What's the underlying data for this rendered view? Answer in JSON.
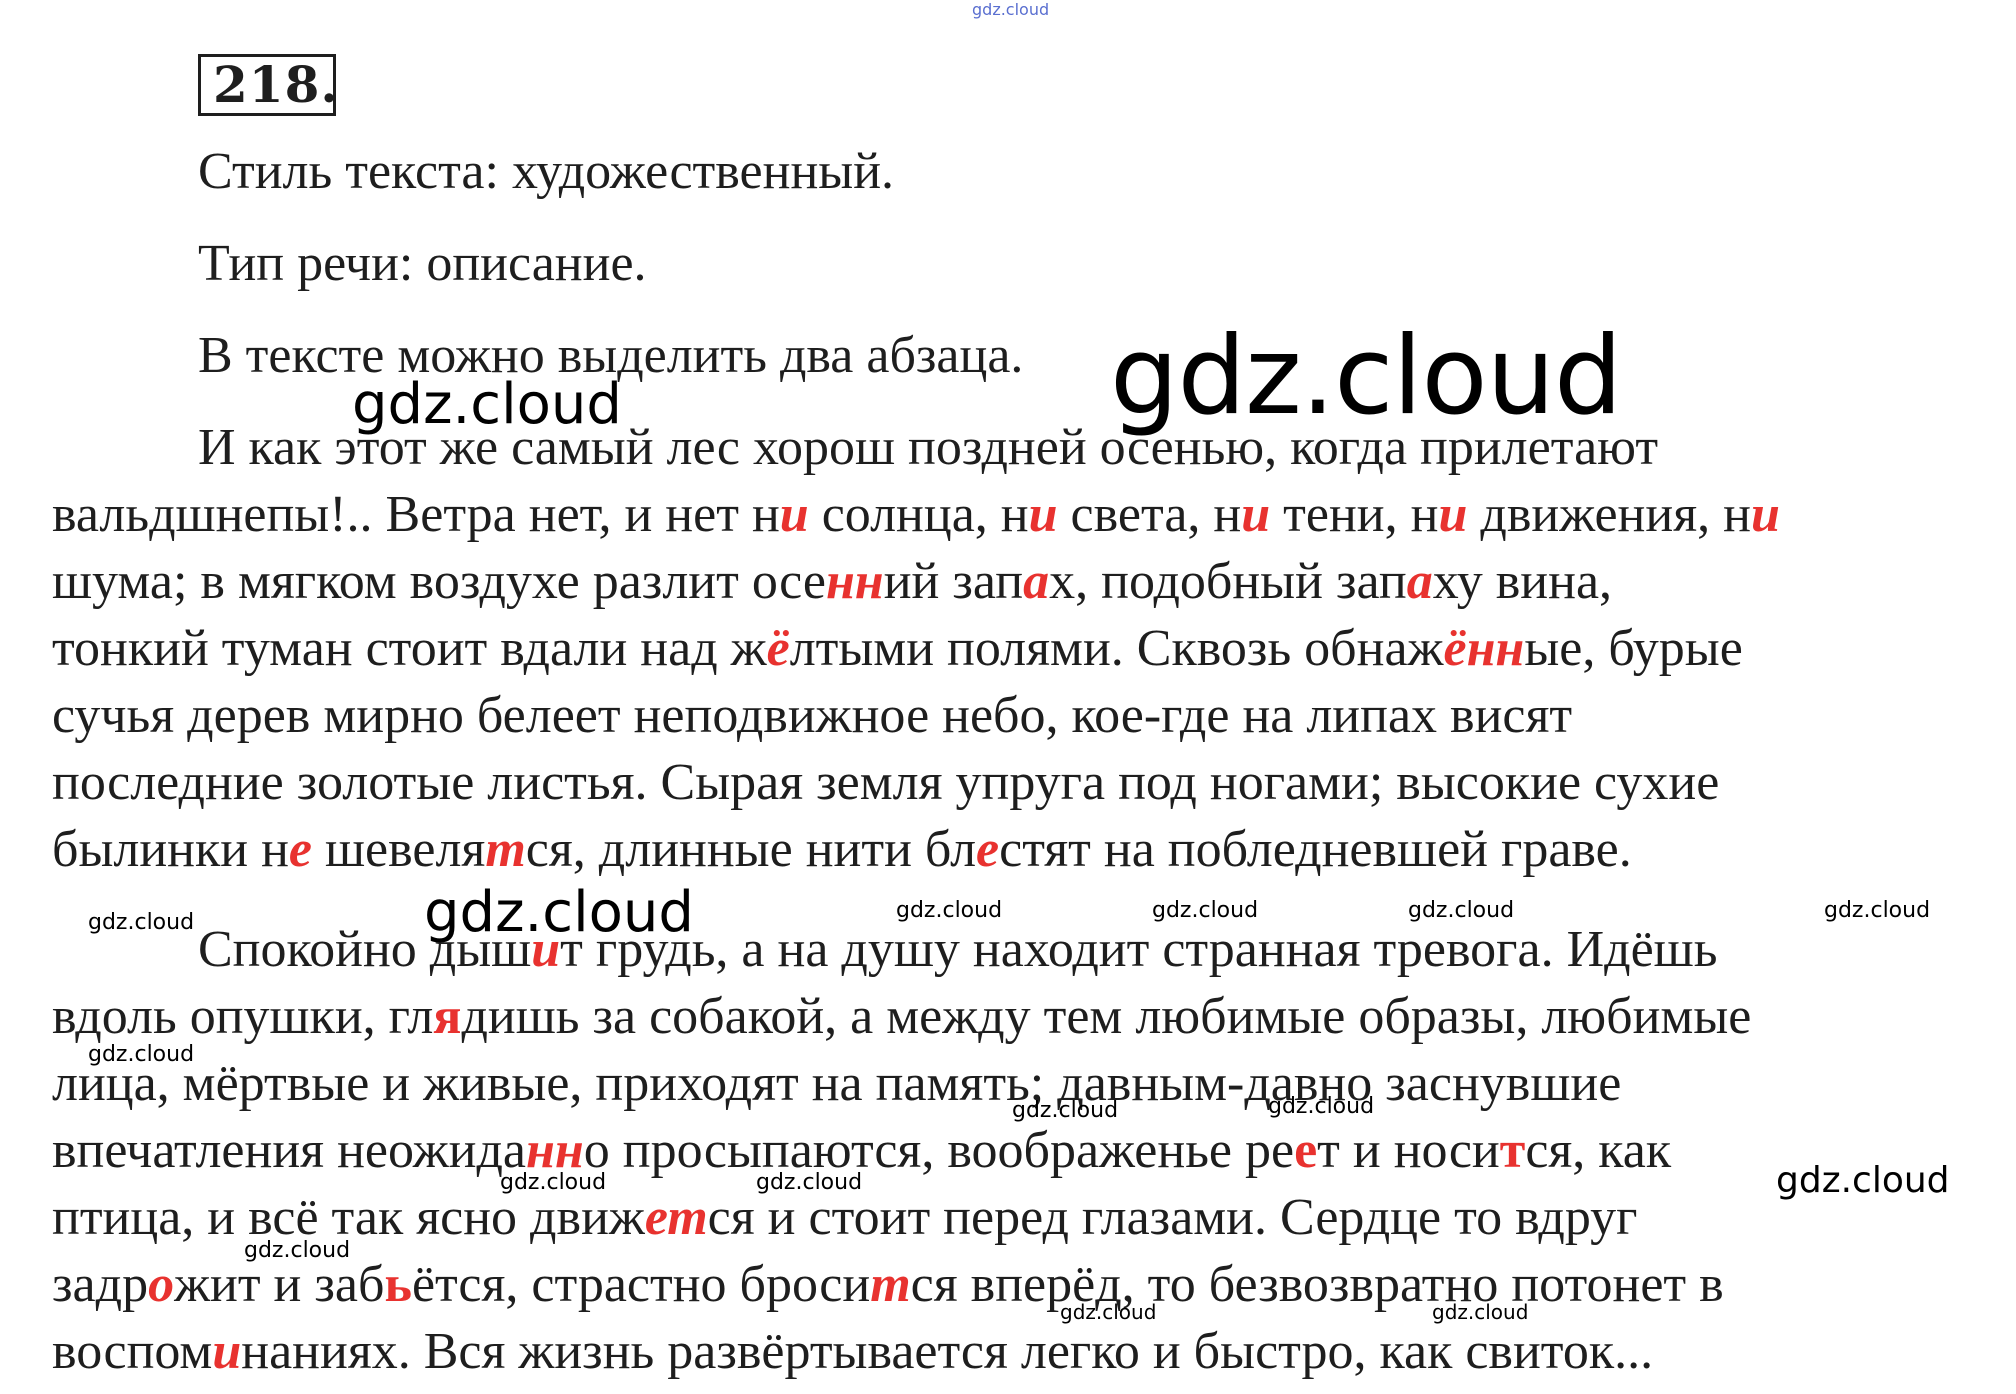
{
  "exercise_number": "218.",
  "meta": {
    "style_line": "Стиль текста: художественный.",
    "type_line": "Тип речи: описание.",
    "paragraphs_line": "В тексте можно выделить два абзаца."
  },
  "paragraph1": [
    [
      {
        "t": "И как этот же самый лес хорош поздней осенью, когда прилетают"
      }
    ],
    [
      {
        "t": "вальдшнепы!.. Ветра нет, и нет н"
      },
      {
        "h": "и"
      },
      {
        "t": " солнца, н"
      },
      {
        "h": "и"
      },
      {
        "t": " света, н"
      },
      {
        "h": "и"
      },
      {
        "t": " тени, н"
      },
      {
        "h": "и"
      },
      {
        "t": " движения, н"
      },
      {
        "h": "и"
      }
    ],
    [
      {
        "t": "шума; в мягком воздухе разлит осе"
      },
      {
        "h": "нн"
      },
      {
        "t": "ий зап"
      },
      {
        "h": "а"
      },
      {
        "t": "х, подобный зап"
      },
      {
        "h": "а"
      },
      {
        "t": "ху вина,"
      }
    ],
    [
      {
        "t": "тонкий туман стоит вдали над ж"
      },
      {
        "h": "ё"
      },
      {
        "t": "лтыми полями. Сквозь обнаж"
      },
      {
        "h": "ённ"
      },
      {
        "t": "ые, бурые"
      }
    ],
    [
      {
        "t": "сучья дерев мирно белеет неподвижное небо, кое-где на липах висят"
      }
    ],
    [
      {
        "t": "последние золотые листья. Сырая земля упруга под ногами; высокие сухие"
      }
    ],
    [
      {
        "t": "былинки н"
      },
      {
        "h": "е"
      },
      {
        "t": " шевеля"
      },
      {
        "h": "т"
      },
      {
        "t": "ся, длинные нити бл"
      },
      {
        "h": "е"
      },
      {
        "t": "стят на побледневшей граве."
      }
    ]
  ],
  "paragraph2": [
    [
      {
        "t": "Спокойно дыш"
      },
      {
        "h": "и"
      },
      {
        "t": "т грудь, а на душу находит странная тревога. Идёшь"
      }
    ],
    [
      {
        "t": "вдоль опушки, гл"
      },
      {
        "u": "я"
      },
      {
        "t": "дишь за собакой, а между тем любимые образы, любимые"
      }
    ],
    [
      {
        "t": "лица, мёртвые и живые, приходят на память; давным-давно заснувшие"
      }
    ],
    [
      {
        "t": "впечатления неожида"
      },
      {
        "h": "нн"
      },
      {
        "t": "о просыпаются, воображенье ре"
      },
      {
        "u": "е"
      },
      {
        "t": "т и носи"
      },
      {
        "u": "т"
      },
      {
        "t": "ся, как"
      }
    ],
    [
      {
        "t": "птица, и всё так ясно движ"
      },
      {
        "h": "ет"
      },
      {
        "t": "ся и стоит перед глазами. Сердце то вдруг"
      }
    ],
    [
      {
        "t": "задр"
      },
      {
        "h": "о"
      },
      {
        "t": "жит и заб"
      },
      {
        "u": "ь"
      },
      {
        "t": "ётся, страстно броси"
      },
      {
        "h": "т"
      },
      {
        "t": "ся вперёд, то безвозвратно потонет в"
      }
    ],
    [
      {
        "t": "воспом"
      },
      {
        "h": "и"
      },
      {
        "t": "наниях. Вся жизнь развёртывается легко и быстро, как свиток..."
      }
    ]
  ],
  "watermark": "gdz.cloud"
}
